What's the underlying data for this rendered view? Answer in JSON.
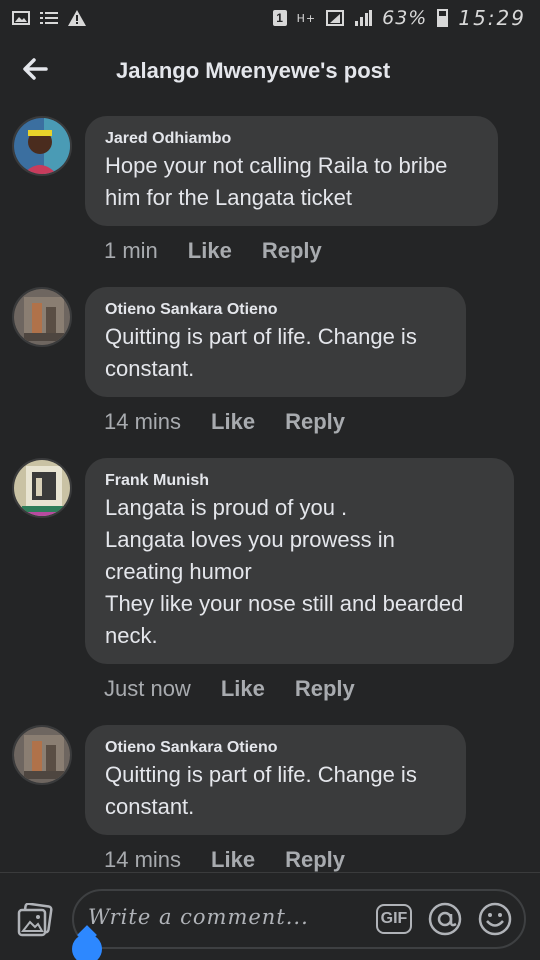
{
  "status_bar": {
    "icons_left": [
      "image-notification-icon",
      "list-notification-icon",
      "warning-icon"
    ],
    "sim": "1",
    "network": "H+",
    "battery": "63%",
    "battery_level": 0.63,
    "time": "15:29"
  },
  "header": {
    "title": "Jalango Mwenyewe's post"
  },
  "comments": [
    {
      "author": "Jared Odhiambo",
      "lines": [
        "Hope your not calling Raila to bribe",
        "him for the Langata ticket"
      ],
      "time": "1 min",
      "like": "Like",
      "reply": "Reply"
    },
    {
      "author": "Otieno Sankara Otieno",
      "lines": [
        "Quitting is part of life. Change is",
        "constant."
      ],
      "time": "14 mins",
      "like": "Like",
      "reply": "Reply"
    },
    {
      "author": "Frank Munish",
      "lines": [
        "Langata is proud of you .",
        "Langata loves you prowess in",
        "creating humor",
        "They like your nose still and bearded",
        "neck."
      ],
      "time": "Just now",
      "like": "Like",
      "reply": "Reply"
    },
    {
      "author": "Otieno Sankara Otieno",
      "lines": [
        "Quitting is part of life. Change is",
        "constant."
      ],
      "time": "14 mins",
      "like": "Like",
      "reply": "Reply"
    }
  ],
  "composer": {
    "placeholder": "Write a comment...",
    "gif_label": "GIF"
  },
  "colors": {
    "background": "#242526",
    "bubble": "#3a3b3c",
    "accent": "#2d88ff"
  }
}
